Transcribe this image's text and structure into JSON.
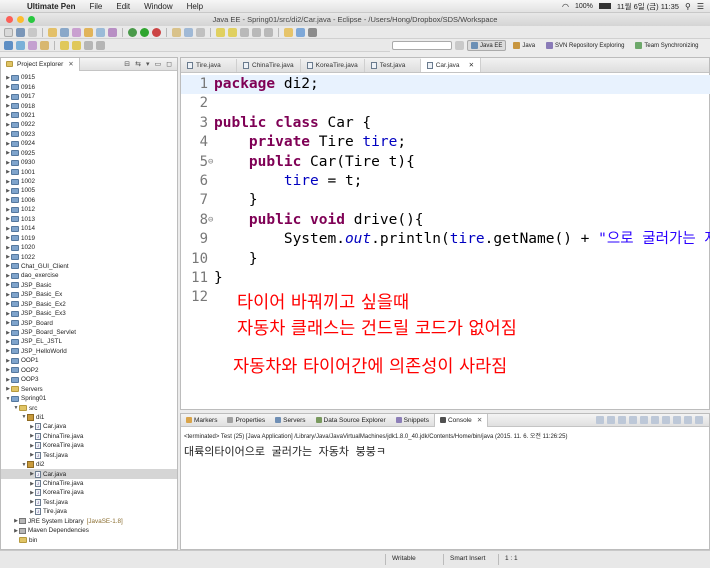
{
  "menubar": {
    "app_name": "Ultimate Pen",
    "items": [
      "File",
      "Edit",
      "Window",
      "Help"
    ],
    "battery": "100%",
    "clock": "11월 6일 (금) 11:35"
  },
  "window": {
    "title": "Java EE - Spring01/src/di2/Car.java - Eclipse - /Users/Hong/Dropbox/SDS/Workspace"
  },
  "perspectives": [
    {
      "label": "Java EE",
      "active": true
    },
    {
      "label": "Java",
      "active": false
    },
    {
      "label": "SVN Repository Exploring",
      "active": false
    },
    {
      "label": "Team Synchronizing",
      "active": false
    }
  ],
  "explorer": {
    "tab_label": "Project Explorer",
    "tree": [
      {
        "label": "0915",
        "depth": 0,
        "kind": "proj",
        "tw": "▶"
      },
      {
        "label": "0916",
        "depth": 0,
        "kind": "proj",
        "tw": "▶"
      },
      {
        "label": "0917",
        "depth": 0,
        "kind": "proj",
        "tw": "▶"
      },
      {
        "label": "0918",
        "depth": 0,
        "kind": "proj",
        "tw": "▶"
      },
      {
        "label": "0921",
        "depth": 0,
        "kind": "proj",
        "tw": "▶"
      },
      {
        "label": "0922",
        "depth": 0,
        "kind": "proj",
        "tw": "▶"
      },
      {
        "label": "0923",
        "depth": 0,
        "kind": "proj",
        "tw": "▶"
      },
      {
        "label": "0924",
        "depth": 0,
        "kind": "proj",
        "tw": "▶"
      },
      {
        "label": "0925",
        "depth": 0,
        "kind": "proj",
        "tw": "▶"
      },
      {
        "label": "0930",
        "depth": 0,
        "kind": "proj",
        "tw": "▶"
      },
      {
        "label": "1001",
        "depth": 0,
        "kind": "proj",
        "tw": "▶"
      },
      {
        "label": "1002",
        "depth": 0,
        "kind": "proj",
        "tw": "▶"
      },
      {
        "label": "1005",
        "depth": 0,
        "kind": "proj",
        "tw": "▶"
      },
      {
        "label": "1006",
        "depth": 0,
        "kind": "proj",
        "tw": "▶"
      },
      {
        "label": "1012",
        "depth": 0,
        "kind": "proj",
        "tw": "▶"
      },
      {
        "label": "1013",
        "depth": 0,
        "kind": "proj",
        "tw": "▶"
      },
      {
        "label": "1014",
        "depth": 0,
        "kind": "proj",
        "tw": "▶"
      },
      {
        "label": "1019",
        "depth": 0,
        "kind": "proj",
        "tw": "▶"
      },
      {
        "label": "1020",
        "depth": 0,
        "kind": "proj",
        "tw": "▶"
      },
      {
        "label": "1022",
        "depth": 0,
        "kind": "proj",
        "tw": "▶"
      },
      {
        "label": "Chat_GUI_Client",
        "depth": 0,
        "kind": "proj",
        "tw": "▶"
      },
      {
        "label": "dao_exercise",
        "depth": 0,
        "kind": "proj",
        "tw": "▶"
      },
      {
        "label": "JSP_Basic",
        "depth": 0,
        "kind": "proj",
        "tw": "▶"
      },
      {
        "label": "JSP_Basic_Ex",
        "depth": 0,
        "kind": "proj",
        "tw": "▶"
      },
      {
        "label": "JSP_Basic_Ex2",
        "depth": 0,
        "kind": "proj",
        "tw": "▶"
      },
      {
        "label": "JSP_Basic_Ex3",
        "depth": 0,
        "kind": "proj",
        "tw": "▶"
      },
      {
        "label": "JSP_Board",
        "depth": 0,
        "kind": "proj",
        "tw": "▶"
      },
      {
        "label": "JSP_Board_Servlet",
        "depth": 0,
        "kind": "proj",
        "tw": "▶"
      },
      {
        "label": "JSP_EL_JSTL",
        "depth": 0,
        "kind": "proj",
        "tw": "▶"
      },
      {
        "label": "JSP_HelloWorld",
        "depth": 0,
        "kind": "proj",
        "tw": "▶"
      },
      {
        "label": "OOP1",
        "depth": 0,
        "kind": "proj",
        "tw": "▶"
      },
      {
        "label": "OOP2",
        "depth": 0,
        "kind": "proj",
        "tw": "▶"
      },
      {
        "label": "OOP3",
        "depth": 0,
        "kind": "proj",
        "tw": "▶"
      },
      {
        "label": "Servers",
        "depth": 0,
        "kind": "fold",
        "tw": "▶"
      },
      {
        "label": "Spring01",
        "depth": 0,
        "kind": "proj",
        "tw": "▼"
      },
      {
        "label": "src",
        "depth": 1,
        "kind": "fold",
        "tw": "▼"
      },
      {
        "label": "di1",
        "depth": 2,
        "kind": "pkg",
        "tw": "▼"
      },
      {
        "label": "Car.java",
        "depth": 3,
        "kind": "java",
        "tw": "▶"
      },
      {
        "label": "ChinaTire.java",
        "depth": 3,
        "kind": "java",
        "tw": "▶"
      },
      {
        "label": "KoreaTire.java",
        "depth": 3,
        "kind": "java",
        "tw": "▶"
      },
      {
        "label": "Test.java",
        "depth": 3,
        "kind": "java",
        "tw": "▶"
      },
      {
        "label": "di2",
        "depth": 2,
        "kind": "pkg",
        "tw": "▼"
      },
      {
        "label": "Car.java",
        "depth": 3,
        "kind": "java",
        "tw": "▶",
        "selected": true
      },
      {
        "label": "ChinaTire.java",
        "depth": 3,
        "kind": "java",
        "tw": "▶"
      },
      {
        "label": "KoreaTire.java",
        "depth": 3,
        "kind": "java",
        "tw": "▶"
      },
      {
        "label": "Test.java",
        "depth": 3,
        "kind": "java",
        "tw": "▶"
      },
      {
        "label": "Tire.java",
        "depth": 3,
        "kind": "java",
        "tw": "▶"
      },
      {
        "label": "JRE System Library",
        "depth": 1,
        "kind": "lib",
        "tw": "▶",
        "suffix": "[JavaSE-1.8]"
      },
      {
        "label": "Maven Dependencies",
        "depth": 1,
        "kind": "lib",
        "tw": "▶"
      },
      {
        "label": "bin",
        "depth": 1,
        "kind": "fold",
        "tw": ""
      }
    ]
  },
  "editor": {
    "tabs": [
      {
        "label": "Tire.java",
        "active": false
      },
      {
        "label": "ChinaTire.java",
        "active": false
      },
      {
        "label": "KoreaTire.java",
        "active": false
      },
      {
        "label": "Test.java",
        "active": false
      },
      {
        "label": "Car.java",
        "active": true
      }
    ],
    "lines": [
      {
        "n": "1",
        "fold": ""
      },
      {
        "n": "2",
        "fold": ""
      },
      {
        "n": "3",
        "fold": ""
      },
      {
        "n": "4",
        "fold": ""
      },
      {
        "n": "5",
        "fold": "⊖"
      },
      {
        "n": "6",
        "fold": ""
      },
      {
        "n": "7",
        "fold": ""
      },
      {
        "n": "8",
        "fold": "⊖"
      },
      {
        "n": "9",
        "fold": ""
      },
      {
        "n": "10",
        "fold": ""
      },
      {
        "n": "11",
        "fold": ""
      },
      {
        "n": "12",
        "fold": ""
      }
    ],
    "code": {
      "l1_kw": "package",
      "l1_rest": " di2;",
      "l3_kw1": "public",
      "l3_kw2": "class",
      "l3_rest": " Car {",
      "l4_kw": "private",
      "l4_type": " Tire ",
      "l4_field": "tire",
      "l4_end": ";",
      "l5_kw": "public",
      "l5_rest": " Car(Tire t){",
      "l6_field": "tire",
      "l6_rest": " = t;",
      "l7": "}",
      "l8_kw1": "public",
      "l8_kw2": "void",
      "l8_rest": " drive(){",
      "l9_a": "System.",
      "l9_out": "out",
      "l9_b": ".println(",
      "l9_field": "tire",
      "l9_c": ".getName() + ",
      "l9_str": "\"으로 굴러가는 자",
      "l10": "}",
      "l11": "}"
    },
    "annotations": [
      "타이어 바꿔끼고 싶을때",
      "자동차 클래스는 건드릴 코드가 없어짐",
      "자동차와 타이어간에 의존성이 사라짐"
    ]
  },
  "console": {
    "tabs": [
      {
        "label": "Markers",
        "active": false
      },
      {
        "label": "Properties",
        "active": false
      },
      {
        "label": "Servers",
        "active": false
      },
      {
        "label": "Data Source Explorer",
        "active": false
      },
      {
        "label": "Snippets",
        "active": false
      },
      {
        "label": "Console",
        "active": true
      }
    ],
    "info": "<terminated> Test (25) [Java Application] /Library/Java/JavaVirtualMachines/jdk1.8.0_40.jdk/Contents/Home/bin/java (2015. 11. 6. 오전 11:26:25)",
    "output": "대륙의타이어으로 굴러가는 자동차 붕붕ㅋ"
  },
  "status": {
    "writable": "Writable",
    "insert_mode": "Smart Insert",
    "position": "1 : 1"
  }
}
